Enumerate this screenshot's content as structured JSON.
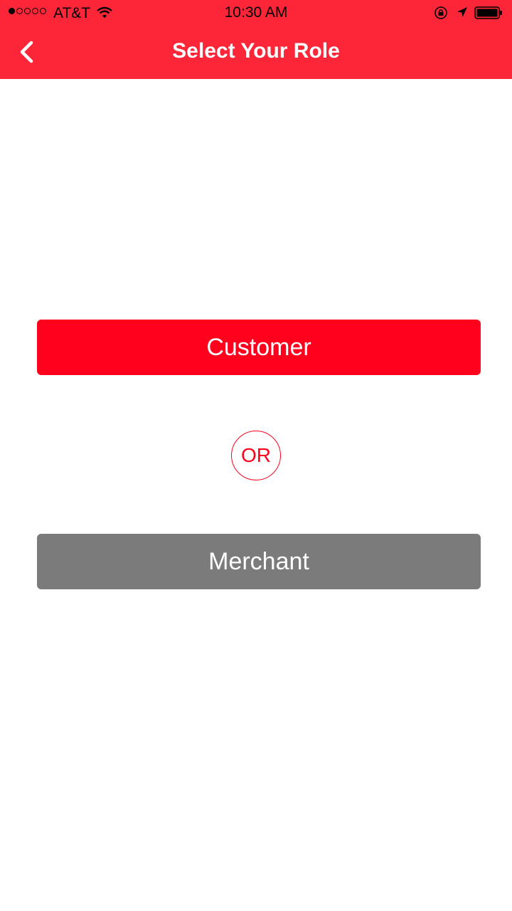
{
  "status_bar": {
    "signal_bars_filled": 1,
    "signal_bars_total": 5,
    "carrier": "AT&T",
    "time": "10:30 AM",
    "icons": [
      "wifi-icon",
      "rotation-lock-icon",
      "location-arrow-icon",
      "battery-icon"
    ]
  },
  "nav": {
    "title": "Select Your Role",
    "back_icon": "chevron-left-icon"
  },
  "roles": {
    "customer_label": "Customer",
    "separator": "OR",
    "merchant_label": "Merchant"
  },
  "colors": {
    "header": "#fd2639",
    "primary_button": "#ff001d",
    "secondary_button": "#7c7b7c",
    "or_accent": "#ff001d"
  }
}
